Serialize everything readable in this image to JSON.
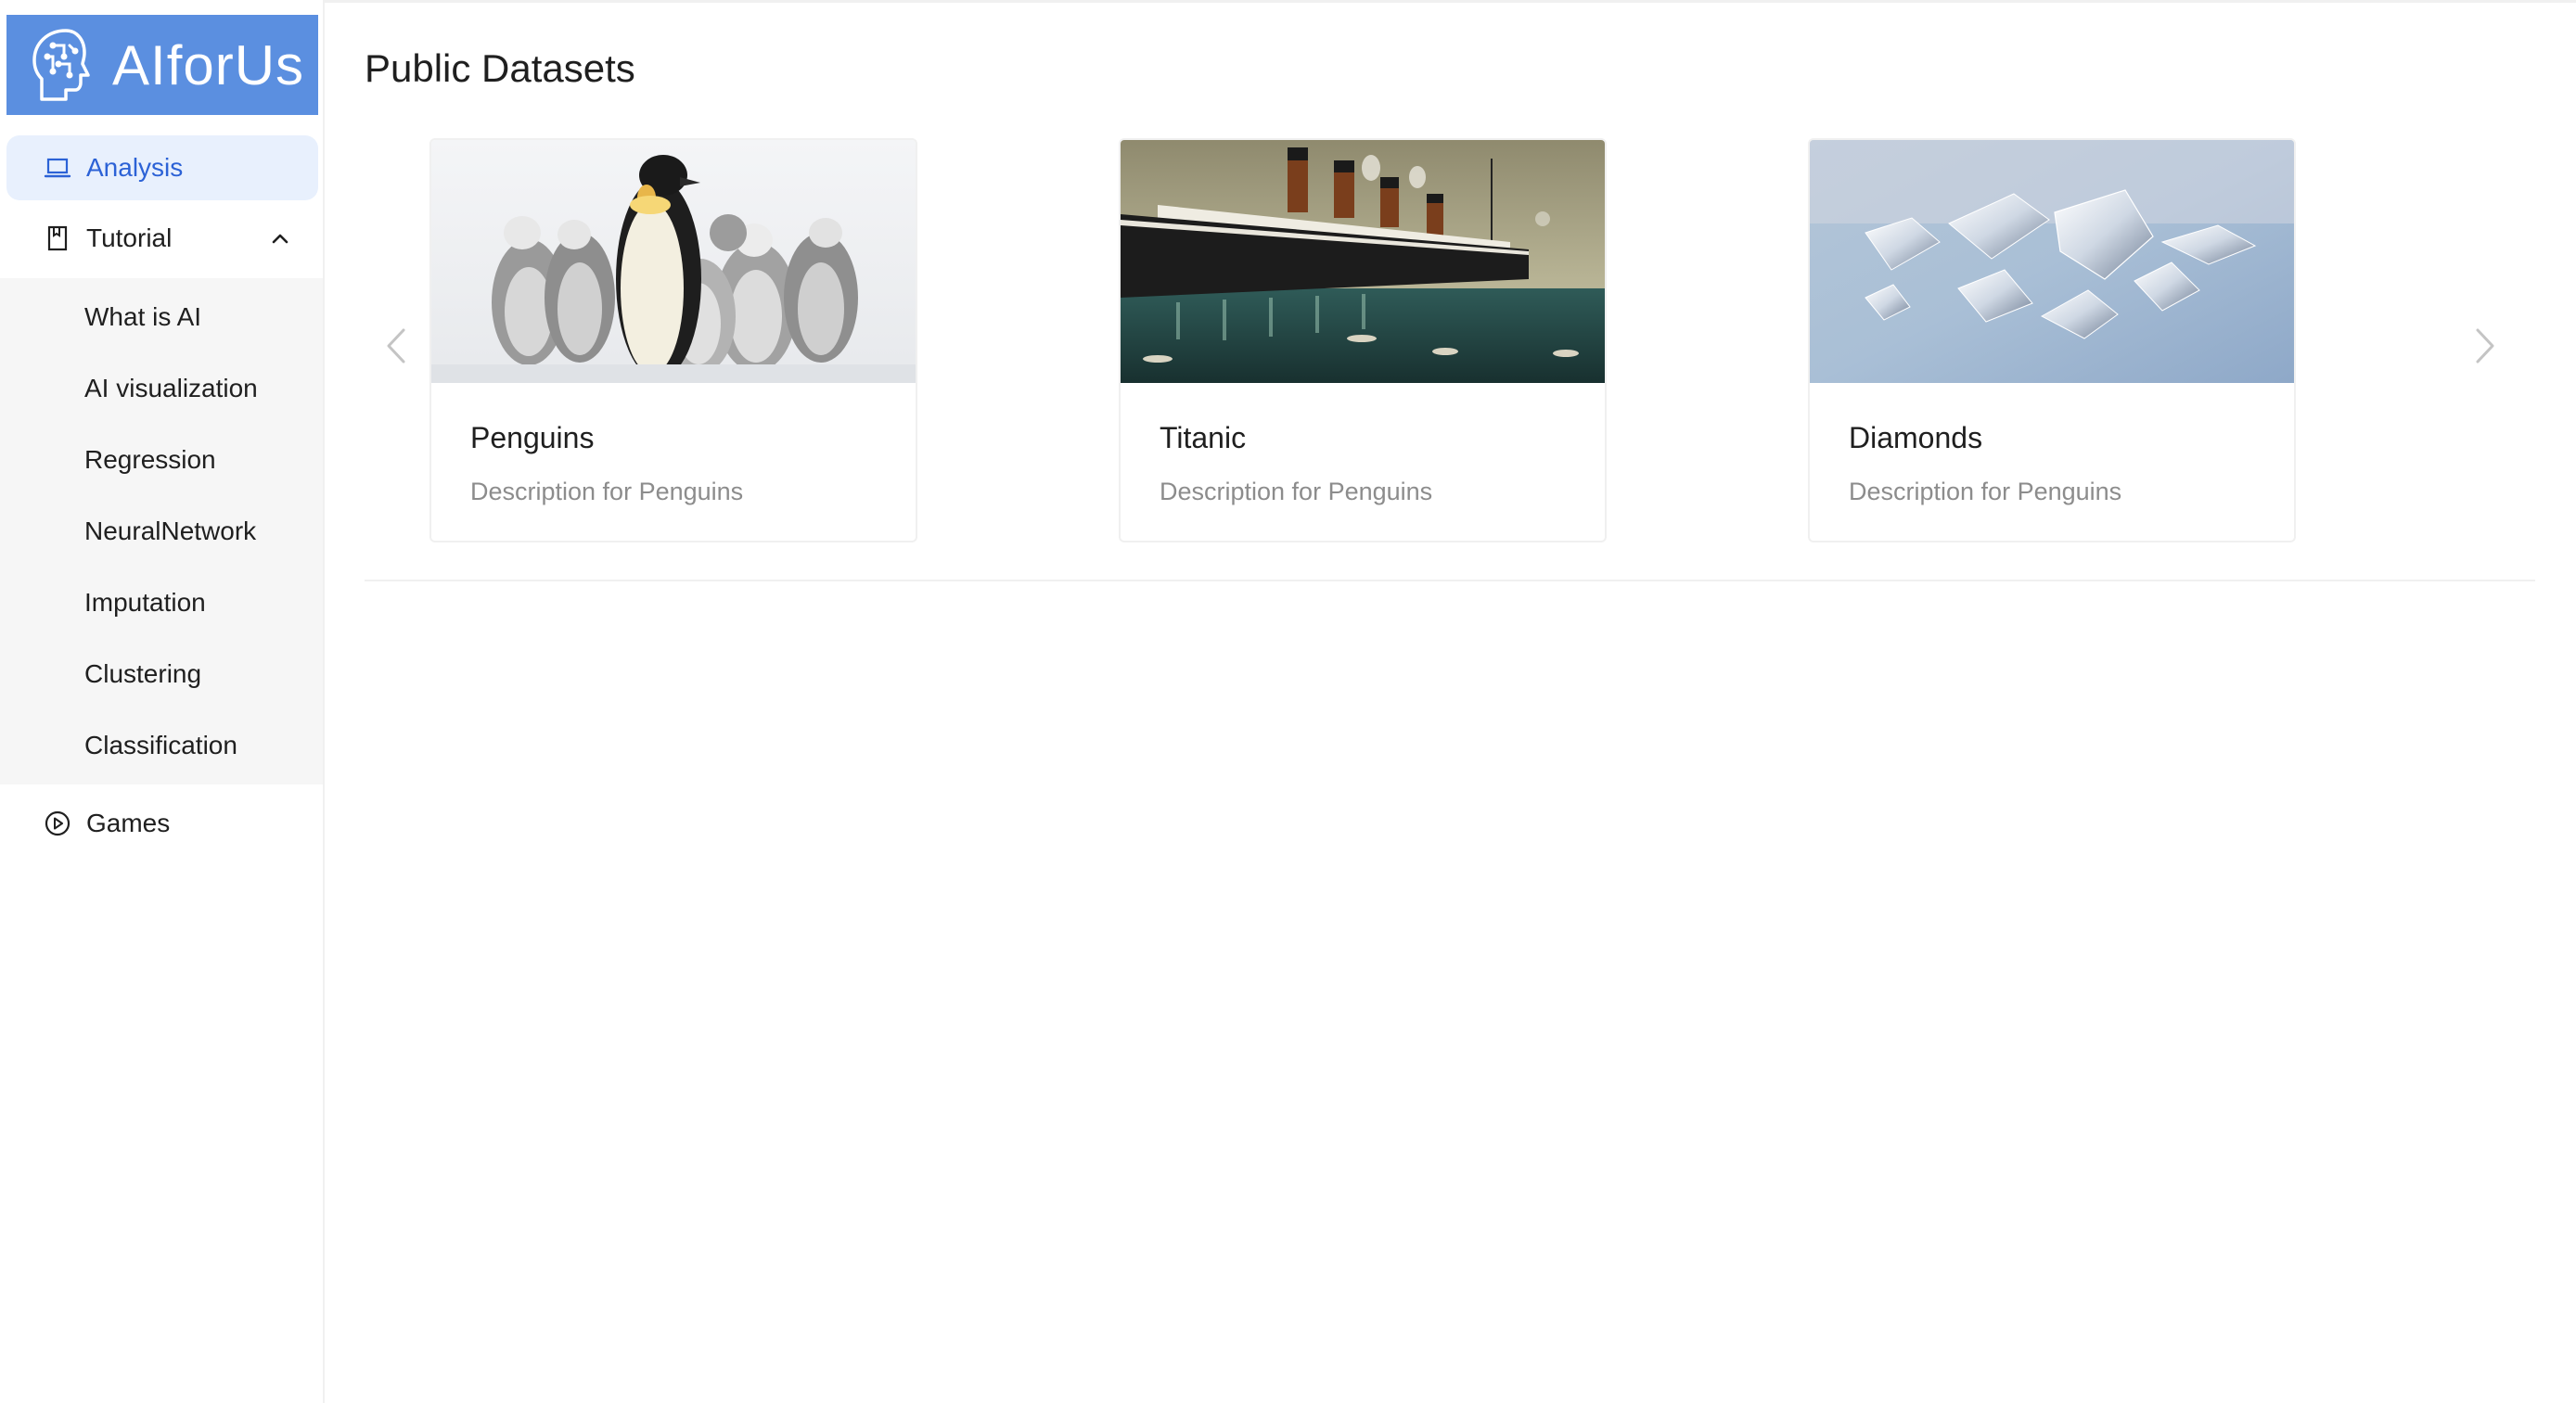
{
  "app": {
    "logo_text": "AIforUs"
  },
  "sidebar": {
    "analysis_label": "Analysis",
    "tutorial_label": "Tutorial",
    "tutorial_expanded": true,
    "sub_items": [
      {
        "label": "What is AI"
      },
      {
        "label": "AI visualization"
      },
      {
        "label": "Regression"
      },
      {
        "label": "NeuralNetwork"
      },
      {
        "label": "Imputation"
      },
      {
        "label": "Clustering"
      },
      {
        "label": "Classification"
      }
    ],
    "games_label": "Games"
  },
  "main": {
    "title": "Public Datasets",
    "cards": [
      {
        "title": "Penguins",
        "description": "Description for Penguins",
        "image": "penguins-photo"
      },
      {
        "title": "Titanic",
        "description": "Description for Penguins",
        "image": "titanic-painting"
      },
      {
        "title": "Diamonds",
        "description": "Description for Penguins",
        "image": "diamonds-photo"
      }
    ]
  },
  "colors": {
    "accent": "#2c62d6",
    "logo_bg": "#5b8fe0",
    "active_bg": "#e8f0fd",
    "submenu_bg": "#f6f6f6",
    "muted_text": "#8c8c8c"
  }
}
